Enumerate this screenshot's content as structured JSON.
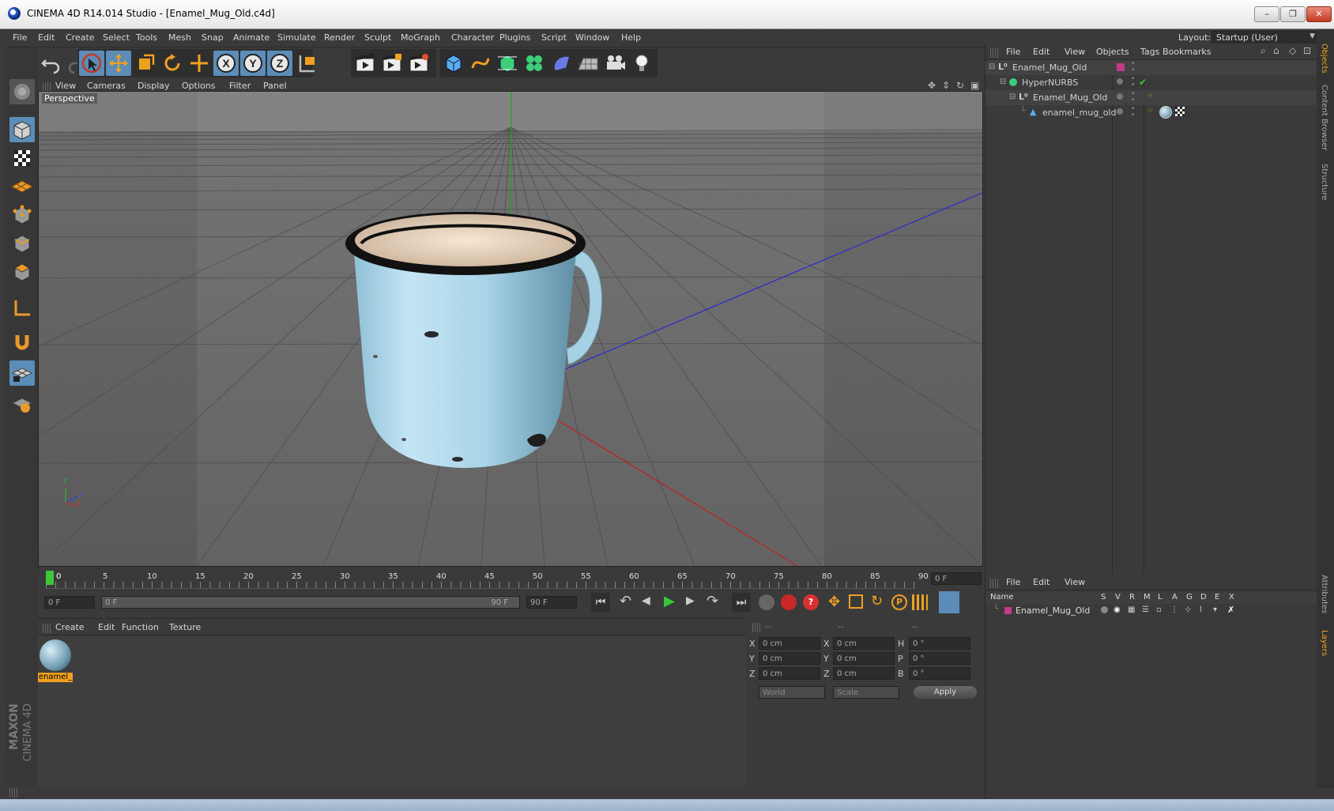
{
  "window": {
    "title": "CINEMA 4D R14.014 Studio - [Enamel_Mug_Old.c4d]",
    "controls": {
      "minimize": "–",
      "restore": "❐",
      "close": "✕"
    }
  },
  "menubar": {
    "items": [
      "File",
      "Edit",
      "Create",
      "Select",
      "Tools",
      "Mesh",
      "Snap",
      "Animate",
      "Simulate",
      "Render",
      "Sculpt",
      "MoGraph",
      "Character",
      "Plugins",
      "Script",
      "Window",
      "Help"
    ],
    "layout_label": "Layout:",
    "layout_value": "Startup (User)"
  },
  "viewport": {
    "menu": [
      "View",
      "Cameras",
      "Display",
      "Options",
      "Filter",
      "Panel"
    ],
    "label": "Perspective",
    "axis_labels": {
      "y": "Y",
      "z": "Z",
      "x": "X"
    }
  },
  "timeline": {
    "ticks": [
      "0",
      "5",
      "10",
      "15",
      "20",
      "25",
      "30",
      "35",
      "40",
      "45",
      "50",
      "55",
      "60",
      "65",
      "70",
      "75",
      "80",
      "85",
      "90"
    ],
    "current_frame": "0 F",
    "start_field": "0 F",
    "range_start": "0 F",
    "range_end": "90 F",
    "end_field": "90 F"
  },
  "material_manager": {
    "menu": [
      "Create",
      "Edit",
      "Function",
      "Texture"
    ],
    "materials": [
      {
        "label": "enamel_"
      }
    ]
  },
  "coordinates": {
    "headers": [
      "--",
      "--",
      "--"
    ],
    "rows": [
      {
        "a": "X",
        "a_val": "0 cm",
        "b": "X",
        "b_val": "0 cm",
        "c": "H",
        "c_val": "0 °"
      },
      {
        "a": "Y",
        "a_val": "0 cm",
        "b": "Y",
        "b_val": "0 cm",
        "c": "P",
        "c_val": "0 °"
      },
      {
        "a": "Z",
        "a_val": "0 cm",
        "b": "Z",
        "b_val": "0 cm",
        "c": "B",
        "c_val": "0 °"
      }
    ],
    "mode1": "World",
    "mode2": "Scale",
    "apply": "Apply"
  },
  "object_manager": {
    "menu": [
      "File",
      "Edit",
      "View",
      "Objects",
      "Tags",
      "Bookmarks"
    ],
    "objects": [
      {
        "name": "Enamel_Mug_Old"
      },
      {
        "name": "HyperNURBS"
      },
      {
        "name": "Enamel_Mug_Old"
      },
      {
        "name": "enamel_mug_old"
      }
    ]
  },
  "layer_manager": {
    "menu": [
      "File",
      "Edit",
      "View"
    ],
    "columns": [
      "Name",
      "S",
      "V",
      "R",
      "M",
      "L",
      "A",
      "G",
      "D",
      "E",
      "X"
    ],
    "layers": [
      {
        "name": "Enamel_Mug_Old"
      }
    ]
  },
  "sidetabs": [
    "Objects",
    "Content Browser",
    "Structure",
    "Attributes",
    "Layers"
  ],
  "branding": {
    "line1": "MAXON",
    "line2": "CINEMA 4D"
  },
  "colors": {
    "accent": "#5b8db8",
    "mug": "#a9d4e8",
    "layer_color": "#c23c8a"
  }
}
